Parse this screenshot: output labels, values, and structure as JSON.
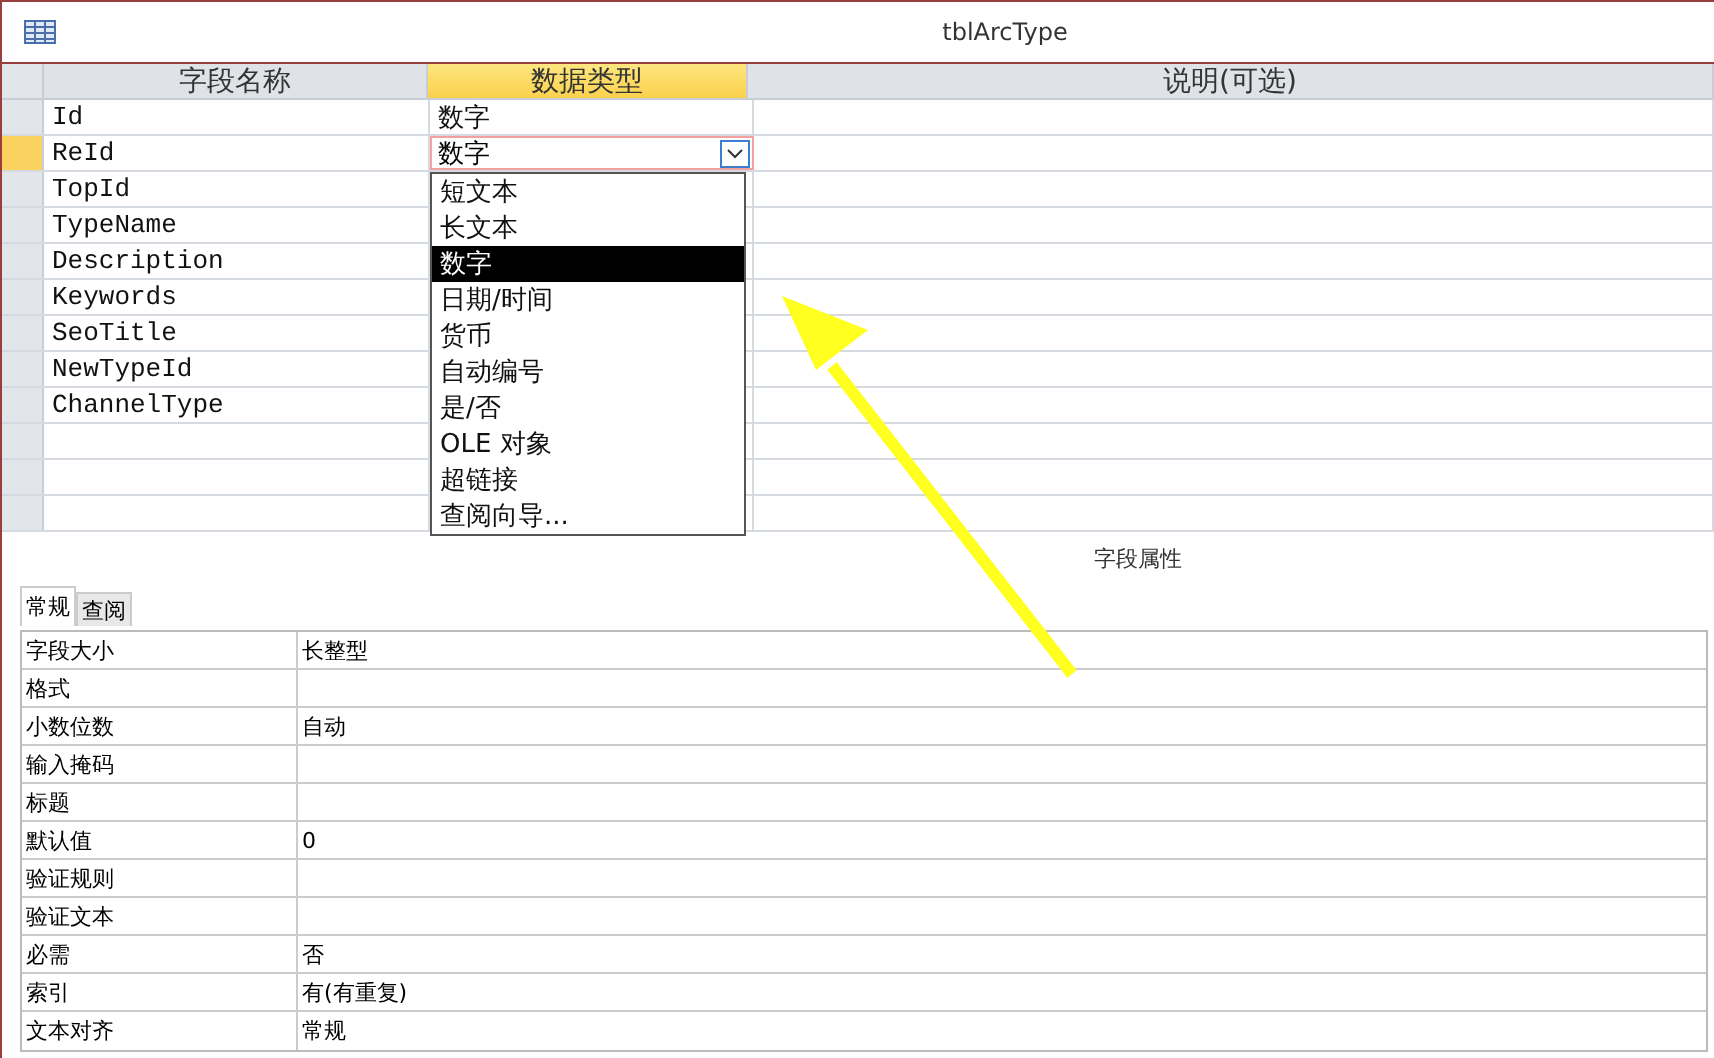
{
  "window": {
    "title": "tblArcType"
  },
  "grid": {
    "columns": [
      {
        "label": "字段名称",
        "selected": false
      },
      {
        "label": "数据类型",
        "selected": true
      },
      {
        "label": "说明(可选)",
        "selected": false
      }
    ],
    "rows": [
      {
        "name": "Id",
        "type": "数字",
        "current": false
      },
      {
        "name": "ReId",
        "type": "数字",
        "current": true
      },
      {
        "name": "TopId",
        "current": false
      },
      {
        "name": "TypeName",
        "current": false
      },
      {
        "name": "Description",
        "current": false
      },
      {
        "name": "Keywords",
        "current": false
      },
      {
        "name": "SeoTitle",
        "current": false
      },
      {
        "name": "NewTypeId",
        "current": false
      },
      {
        "name": "ChannelType",
        "current": false
      }
    ]
  },
  "dropdown": {
    "options": [
      {
        "label": "短文本",
        "selected": false
      },
      {
        "label": "长文本",
        "selected": false
      },
      {
        "label": "数字",
        "selected": true
      },
      {
        "label": "日期/时间",
        "selected": false
      },
      {
        "label": "货币",
        "selected": false
      },
      {
        "label": "自动编号",
        "selected": false
      },
      {
        "label": "是/否",
        "selected": false
      },
      {
        "label": "OLE 对象",
        "selected": false
      },
      {
        "label": "超链接",
        "selected": false
      },
      {
        "label": "查阅向导...",
        "selected": false
      }
    ]
  },
  "section_label": "字段属性",
  "tabs": [
    {
      "label": "常规",
      "selected": true
    },
    {
      "label": "查阅",
      "selected": false
    }
  ],
  "properties": [
    {
      "label": "字段大小",
      "value": "长整型"
    },
    {
      "label": "格式"
    },
    {
      "label": "小数位数",
      "value": "自动"
    },
    {
      "label": "输入掩码"
    },
    {
      "label": "标题"
    },
    {
      "label": "默认值",
      "value": "0"
    },
    {
      "label": "验证规则"
    },
    {
      "label": "验证文本"
    },
    {
      "label": "必需",
      "value": "否"
    },
    {
      "label": "索引",
      "value": "有(有重复)"
    },
    {
      "label": "文本对齐",
      "value": "常规"
    }
  ]
}
